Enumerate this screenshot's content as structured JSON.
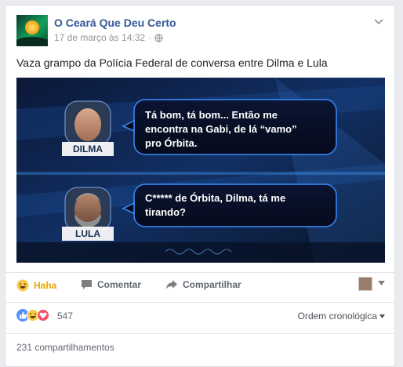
{
  "post": {
    "page_name": "O Ceará Que Deu Certo",
    "timestamp": "17 de março às 14:32",
    "text": "Vaza grampo da Polícia Federal de conversa entre Dilma e Lula"
  },
  "image": {
    "bubble1": {
      "speaker": "DILMA",
      "lines": [
        "Tá bom, tá bom... Então me",
        "encontra na Gabi, de lá “vamo”",
        "pro Órbita."
      ]
    },
    "bubble2": {
      "speaker": "LULA",
      "lines": [
        "C***** de Órbita, Dilma, tá me",
        "tirando?"
      ]
    }
  },
  "actions": {
    "haha_label": "Haha",
    "comment_label": "Comentar",
    "share_label": "Compartilhar"
  },
  "reactions": {
    "count": "547",
    "order_label": "Ordem cronológica"
  },
  "shares": {
    "label": "231 compartilhamentos"
  },
  "colors": {
    "link": "#365899",
    "haha": "#e5a600",
    "like_blue": "#5890ff",
    "love_red": "#f25268"
  },
  "icons": [
    "globe-icon",
    "chevron-down-icon",
    "haha-icon",
    "comment-icon",
    "share-arrow-icon",
    "caret-down-icon",
    "like-reaction-icon",
    "love-reaction-icon"
  ]
}
